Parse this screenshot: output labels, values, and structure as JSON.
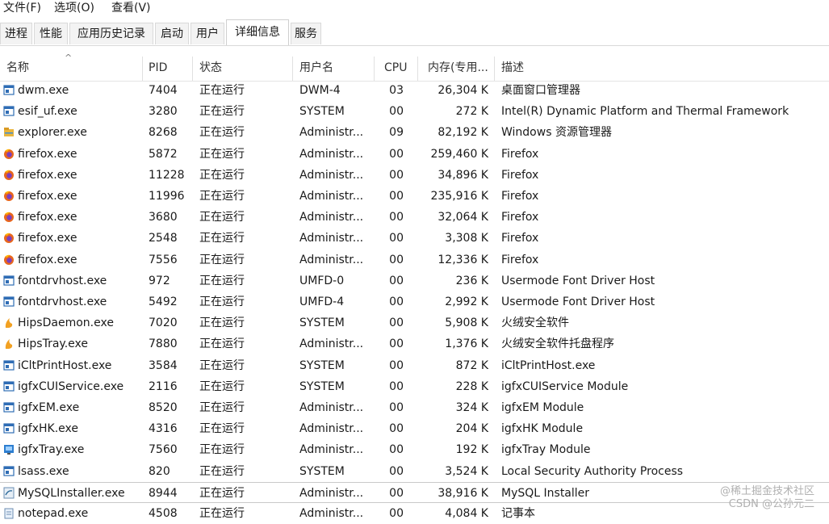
{
  "menu": [
    "文件(F)",
    "选项(O)",
    "查看(V)"
  ],
  "tabs": [
    "进程",
    "性能",
    "应用历史记录",
    "启动",
    "用户",
    "详细信息",
    "服务"
  ],
  "active_tab": "详细信息",
  "columns": {
    "name": "名称",
    "pid": "PID",
    "status": "状态",
    "user": "用户名",
    "cpu": "CPU",
    "mem": "内存(专用...",
    "desc": "描述"
  },
  "rows": [
    {
      "name": "dwm.exe",
      "pid": "7404",
      "status": "正在运行",
      "user": "DWM-4",
      "cpu": "03",
      "mem": "26,304 K",
      "desc": "桌面窗口管理器",
      "icon": "window-icon"
    },
    {
      "name": "esif_uf.exe",
      "pid": "3280",
      "status": "正在运行",
      "user": "SYSTEM",
      "cpu": "00",
      "mem": "272 K",
      "desc": "Intel(R) Dynamic Platform and Thermal Framework",
      "icon": "window-icon"
    },
    {
      "name": "explorer.exe",
      "pid": "8268",
      "status": "正在运行",
      "user": "Administr...",
      "cpu": "09",
      "mem": "82,192 K",
      "desc": "Windows 资源管理器",
      "icon": "folder-icon"
    },
    {
      "name": "firefox.exe",
      "pid": "5872",
      "status": "正在运行",
      "user": "Administr...",
      "cpu": "00",
      "mem": "259,460 K",
      "desc": "Firefox",
      "icon": "firefox-icon"
    },
    {
      "name": "firefox.exe",
      "pid": "11228",
      "status": "正在运行",
      "user": "Administr...",
      "cpu": "00",
      "mem": "34,896 K",
      "desc": "Firefox",
      "icon": "firefox-icon"
    },
    {
      "name": "firefox.exe",
      "pid": "11996",
      "status": "正在运行",
      "user": "Administr...",
      "cpu": "00",
      "mem": "235,916 K",
      "desc": "Firefox",
      "icon": "firefox-icon"
    },
    {
      "name": "firefox.exe",
      "pid": "3680",
      "status": "正在运行",
      "user": "Administr...",
      "cpu": "00",
      "mem": "32,064 K",
      "desc": "Firefox",
      "icon": "firefox-icon"
    },
    {
      "name": "firefox.exe",
      "pid": "2548",
      "status": "正在运行",
      "user": "Administr...",
      "cpu": "00",
      "mem": "3,308 K",
      "desc": "Firefox",
      "icon": "firefox-icon"
    },
    {
      "name": "firefox.exe",
      "pid": "7556",
      "status": "正在运行",
      "user": "Administr...",
      "cpu": "00",
      "mem": "12,336 K",
      "desc": "Firefox",
      "icon": "firefox-icon"
    },
    {
      "name": "fontdrvhost.exe",
      "pid": "972",
      "status": "正在运行",
      "user": "UMFD-0",
      "cpu": "00",
      "mem": "236 K",
      "desc": "Usermode Font Driver Host",
      "icon": "window-icon"
    },
    {
      "name": "fontdrvhost.exe",
      "pid": "5492",
      "status": "正在运行",
      "user": "UMFD-4",
      "cpu": "00",
      "mem": "2,992 K",
      "desc": "Usermode Font Driver Host",
      "icon": "window-icon"
    },
    {
      "name": "HipsDaemon.exe",
      "pid": "7020",
      "status": "正在运行",
      "user": "SYSTEM",
      "cpu": "00",
      "mem": "5,908 K",
      "desc": "火绒安全软件",
      "icon": "huorong-icon"
    },
    {
      "name": "HipsTray.exe",
      "pid": "7880",
      "status": "正在运行",
      "user": "Administr...",
      "cpu": "00",
      "mem": "1,376 K",
      "desc": "火绒安全软件托盘程序",
      "icon": "huorong-icon"
    },
    {
      "name": "iCltPrintHost.exe",
      "pid": "3584",
      "status": "正在运行",
      "user": "SYSTEM",
      "cpu": "00",
      "mem": "872 K",
      "desc": "iCltPrintHost.exe",
      "icon": "window-icon"
    },
    {
      "name": "igfxCUIService.exe",
      "pid": "2116",
      "status": "正在运行",
      "user": "SYSTEM",
      "cpu": "00",
      "mem": "228 K",
      "desc": "igfxCUIService Module",
      "icon": "window-icon"
    },
    {
      "name": "igfxEM.exe",
      "pid": "8520",
      "status": "正在运行",
      "user": "Administr...",
      "cpu": "00",
      "mem": "324 K",
      "desc": "igfxEM Module",
      "icon": "window-icon"
    },
    {
      "name": "igfxHK.exe",
      "pid": "4316",
      "status": "正在运行",
      "user": "Administr...",
      "cpu": "00",
      "mem": "204 K",
      "desc": "igfxHK Module",
      "icon": "window-icon"
    },
    {
      "name": "igfxTray.exe",
      "pid": "7560",
      "status": "正在运行",
      "user": "Administr...",
      "cpu": "00",
      "mem": "192 K",
      "desc": "igfxTray Module",
      "icon": "intel-tray-icon"
    },
    {
      "name": "lsass.exe",
      "pid": "820",
      "status": "正在运行",
      "user": "SYSTEM",
      "cpu": "00",
      "mem": "3,524 K",
      "desc": "Local Security Authority Process",
      "icon": "window-icon"
    },
    {
      "name": "MySQLInstaller.exe",
      "pid": "8944",
      "status": "正在运行",
      "user": "Administr...",
      "cpu": "00",
      "mem": "38,916 K",
      "desc": "MySQL Installer",
      "icon": "mysql-icon"
    },
    {
      "name": "notepad.exe",
      "pid": "4508",
      "status": "正在运行",
      "user": "Administr...",
      "cpu": "00",
      "mem": "4,084 K",
      "desc": "记事本",
      "icon": "notepad-icon"
    }
  ],
  "watermark": [
    "@稀土掘金技术社区",
    "CSDN @公孙元二"
  ],
  "colors": {
    "firefox": "#e8661d",
    "window": "#2f6db5",
    "folder": "#e9b53d",
    "huorong": "#f2a122"
  }
}
